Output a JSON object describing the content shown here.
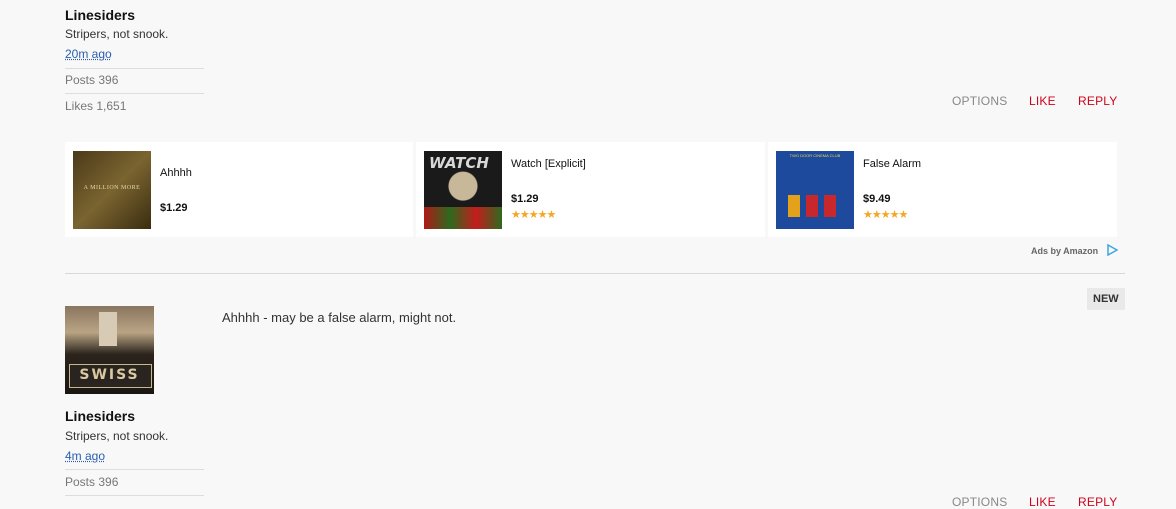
{
  "post1": {
    "username": "Linesiders",
    "tagline": "Stripers, not snook.",
    "time": "20m ago",
    "posts": "Posts 396",
    "likes": "Likes 1,651",
    "actions": {
      "options": "OPTIONS",
      "like": "LIKE",
      "reply": "REPLY"
    }
  },
  "ads": {
    "items": [
      {
        "title": "Ahhhh",
        "price": "$1.29",
        "cover_text": "A MILLION MORE",
        "stars": ""
      },
      {
        "title": "Watch [Explicit]",
        "price": "$1.29",
        "cover_text": "WATCH",
        "stars": "★★★★★"
      },
      {
        "title": "False Alarm",
        "price": "$9.49",
        "cover_text": "TWO DOOR CINEMA CLUB",
        "stars": "★★★★★"
      }
    ],
    "attribution": "Ads by Amazon"
  },
  "post2": {
    "badge": "NEW",
    "text": "Ahhhh - may be a false alarm, might not.",
    "avatar_text": "SWISS",
    "username": "Linesiders",
    "tagline": "Stripers, not snook.",
    "time": "4m ago",
    "posts": "Posts 396",
    "actions": {
      "options": "OPTIONS",
      "like": "LIKE",
      "reply": "REPLY"
    }
  },
  "colors": {
    "accent_red": "#d0021b",
    "link_blue": "#2a5db0",
    "star": "#f5a623"
  }
}
